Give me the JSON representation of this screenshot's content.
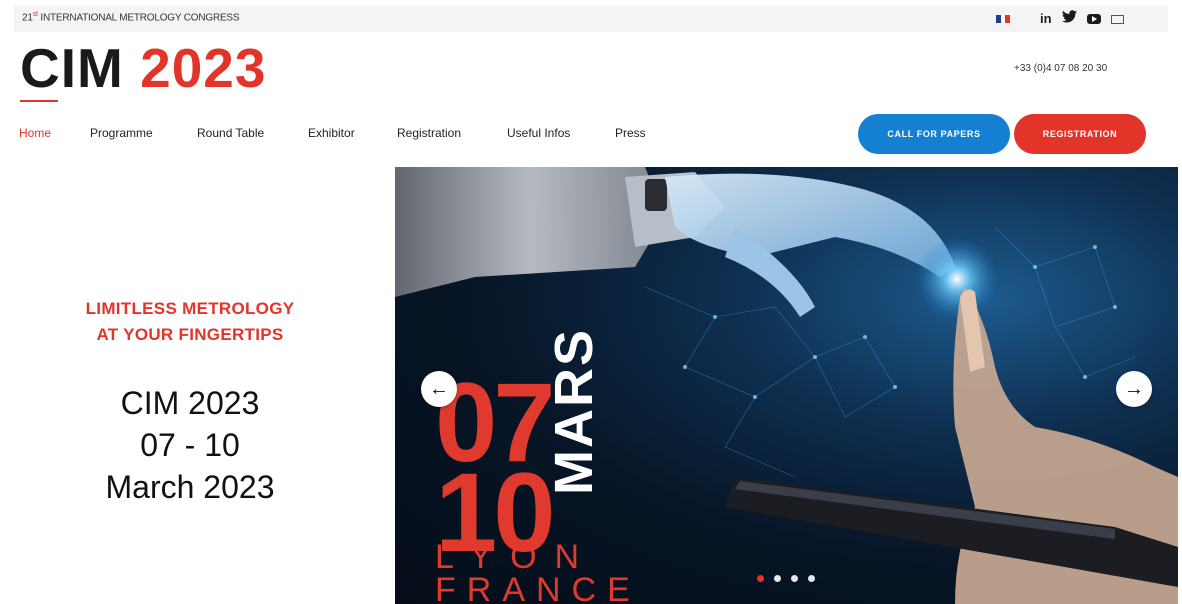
{
  "topbar": {
    "congress_num": "21",
    "congress_sup": "st",
    "congress_text": "INTERNATIONAL METROLOGY CONGRESS",
    "social": {
      "linkedin": "in",
      "twitter": "🐦"
    }
  },
  "header": {
    "logo_cim": "CIM",
    "logo_year": "2023",
    "phone": "+33 (0)4 07 08 20 30"
  },
  "nav": {
    "items": [
      {
        "label": "Home",
        "active": true
      },
      {
        "label": "Programme",
        "active": false
      },
      {
        "label": "Round Table",
        "active": false
      },
      {
        "label": "Exhibitor",
        "active": false
      },
      {
        "label": "Registration",
        "active": false
      },
      {
        "label": "Useful Infos",
        "active": false
      },
      {
        "label": "Press",
        "active": false
      }
    ],
    "call_for_papers": "CALL FOR PAPERS",
    "registration": "REGISTRATION"
  },
  "hero": {
    "tagline_line1": "LIMITLESS METROLOGY",
    "tagline_line2": "AT YOUR FINGERTIPS",
    "event_name": "CIM 2023",
    "event_days": "07 - 10",
    "event_month": "March 2023",
    "slide_day_start": "07",
    "slide_day_end": "10",
    "slide_month": "MARS",
    "slide_city": "LYON",
    "slide_country": "FRANCE",
    "prev_arrow": "←",
    "next_arrow": "→",
    "slides_total": 4,
    "slide_active": 1
  },
  "colors": {
    "brand_red": "#e3342a",
    "brand_blue": "#1580d2",
    "dark": "#1a1a1a"
  }
}
